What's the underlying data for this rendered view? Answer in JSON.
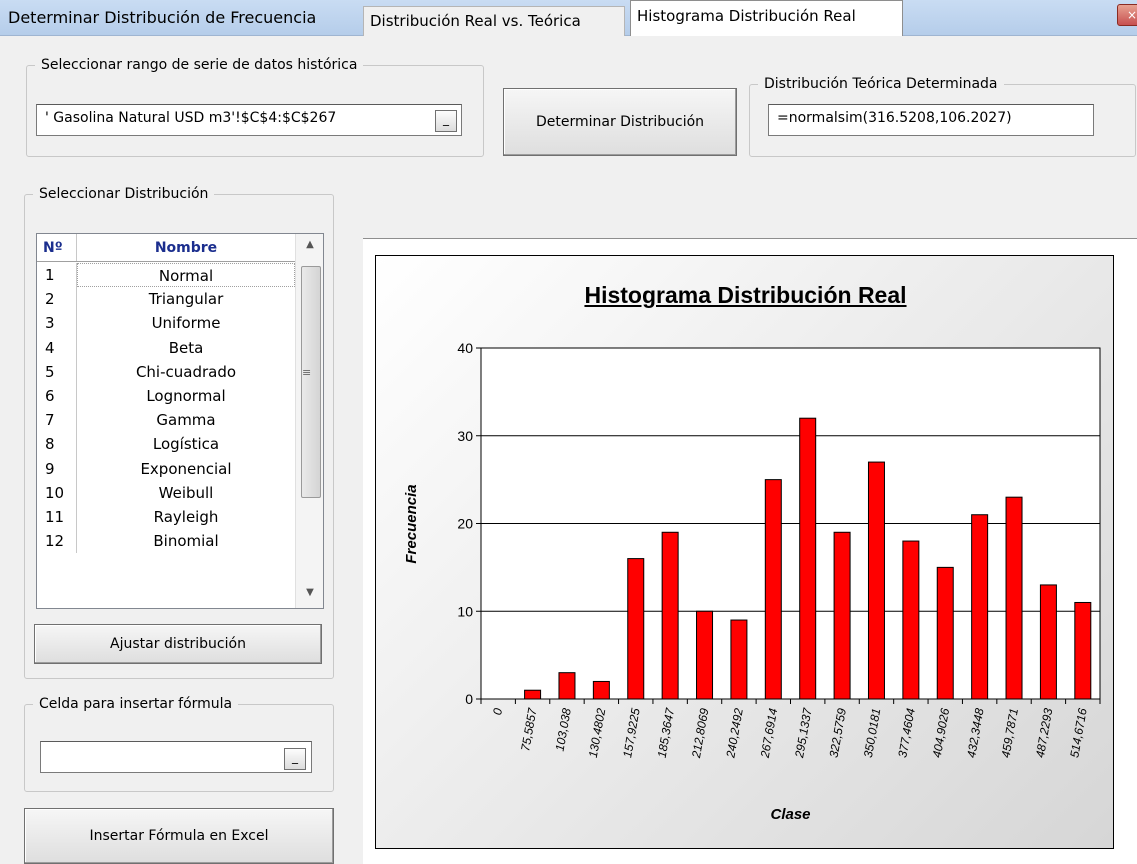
{
  "window": {
    "title": "Determinar Distribución de Frecuencia",
    "close_label": "×"
  },
  "range_group": {
    "legend": "Seleccionar rango de serie de datos histórica",
    "value": "' Gasolina Natural USD m3'!$C$4:$C$267",
    "ref_button": "_"
  },
  "determine_button": "Determinar Distribución",
  "theoretical_group": {
    "legend": "Distribución Teórica Determinada",
    "value": "=normalsim(316.5208,106.2027)"
  },
  "distribution_group": {
    "legend": "Seleccionar Distribución",
    "header_no": "Nº",
    "header_name": "Nombre",
    "rows": [
      {
        "no": "1",
        "name": "Normal"
      },
      {
        "no": "2",
        "name": "Triangular"
      },
      {
        "no": "3",
        "name": "Uniforme"
      },
      {
        "no": "4",
        "name": "Beta"
      },
      {
        "no": "5",
        "name": "Chi-cuadrado"
      },
      {
        "no": "6",
        "name": "Lognormal"
      },
      {
        "no": "7",
        "name": "Gamma"
      },
      {
        "no": "8",
        "name": "Logística"
      },
      {
        "no": "9",
        "name": "Exponencial"
      },
      {
        "no": "10",
        "name": "Weibull"
      },
      {
        "no": "11",
        "name": "Rayleigh"
      },
      {
        "no": "12",
        "name": "Binomial"
      }
    ],
    "adjust_button": "Ajustar distribución"
  },
  "cell_group": {
    "legend": "Celda para insertar fórmula",
    "value": "",
    "ref_button": "_"
  },
  "insert_button": "Insertar Fórmula en Excel",
  "tabs": [
    {
      "label": "Distribución Real vs. Teórica",
      "active": false
    },
    {
      "label": "Histograma Distribución Real",
      "active": true
    }
  ],
  "chart_data": {
    "type": "bar",
    "title": "Histograma Distribución Real",
    "xlabel": "Clase",
    "ylabel": "Frecuencia",
    "ylim": [
      0,
      40
    ],
    "yticks": [
      0,
      10,
      20,
      30,
      40
    ],
    "grid": true,
    "bar_color": "#ff0000",
    "categories": [
      "0",
      "75,5857",
      "103,038",
      "130,4802",
      "157,9225",
      "185,3647",
      "212,8069",
      "240,2492",
      "267,6914",
      "295,1337",
      "322,5759",
      "350,0181",
      "377,4604",
      "404,9026",
      "432,3448",
      "459,7871",
      "487,2293",
      "514,6716"
    ],
    "values": [
      0,
      1,
      3,
      2,
      16,
      19,
      10,
      9,
      25,
      32,
      19,
      27,
      18,
      15,
      21,
      23,
      13,
      11
    ]
  }
}
